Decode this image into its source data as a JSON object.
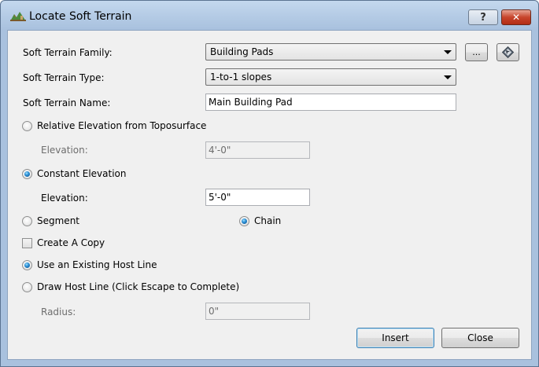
{
  "window": {
    "title": "Locate Soft Terrain",
    "help_label": "?",
    "close_label": "✕"
  },
  "family": {
    "label": "Soft Terrain Family:",
    "value": "Building Pads",
    "browse_label": "..."
  },
  "type": {
    "label": "Soft Terrain Type:",
    "value": "1-to-1 slopes"
  },
  "name": {
    "label": "Soft Terrain Name:",
    "value": "Main Building Pad"
  },
  "relative_elevation": {
    "label": "Relative Elevation from Toposurface",
    "checked": false,
    "elevation_label": "Elevation:",
    "elevation_value": "4'-0\""
  },
  "constant_elevation": {
    "label": "Constant Elevation",
    "checked": true,
    "elevation_label": "Elevation:",
    "elevation_value": "5'-0\""
  },
  "segment": {
    "label": "Segment",
    "checked": false
  },
  "chain": {
    "label": "Chain",
    "checked": true
  },
  "create_copy": {
    "label": "Create A Copy",
    "checked": false
  },
  "existing_host": {
    "label": "Use an Existing Host Line",
    "checked": true
  },
  "draw_host": {
    "label": "Draw Host Line (Click Escape to Complete)",
    "checked": false
  },
  "radius": {
    "label": "Radius:",
    "value": "0\""
  },
  "actions": {
    "insert_label": "Insert",
    "close_label": "Close"
  },
  "colors": {
    "frame": "#a9c1de",
    "client": "#f0f0f0",
    "close_button": "#c7452c",
    "radio_selected": "#2c8fd6"
  }
}
